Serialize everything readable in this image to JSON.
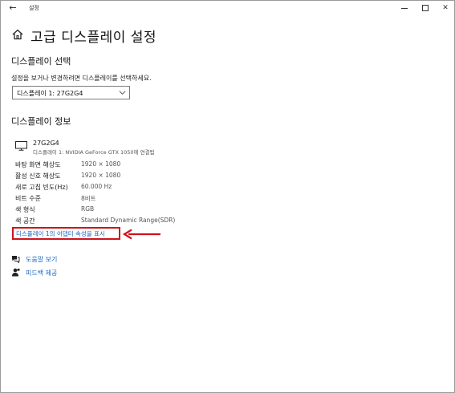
{
  "window": {
    "title": "설정",
    "back_glyph": "←",
    "min_label": "minimize",
    "max_label": "maximize",
    "close_glyph": "✕"
  },
  "page": {
    "title": "고급 디스플레이 설정",
    "home_icon": "home-icon"
  },
  "display_select": {
    "heading": "디스플레이 선택",
    "description": "설정을 보거나 변경하려면 디스플레이를 선택하세요.",
    "selected": "디스플레이 1: 27G2G4"
  },
  "display_info": {
    "heading": "디스플레이 정보",
    "monitor_name": "27G2G4",
    "monitor_sub": "디스플레이 1: NVIDIA GeForce GTX 1050에 연결됨",
    "rows": [
      {
        "label": "바탕 화면 해상도",
        "value": "1920 × 1080"
      },
      {
        "label": "활성 신호 해상도",
        "value": "1920 × 1080"
      },
      {
        "label": "새로 고침 빈도(Hz)",
        "value": "60.000 Hz"
      },
      {
        "label": "비트 수준",
        "value": "8비트"
      },
      {
        "label": "색 형식",
        "value": "RGB"
      },
      {
        "label": "색 공간",
        "value": "Standard Dynamic Range(SDR)"
      }
    ],
    "adapter_link": "디스플레이 1의 어댑터 속성을 표시"
  },
  "footer": {
    "help": "도움말 보기",
    "feedback": "피드백 제공"
  },
  "colors": {
    "link": "#1a66c2",
    "highlight": "#d0131b"
  }
}
